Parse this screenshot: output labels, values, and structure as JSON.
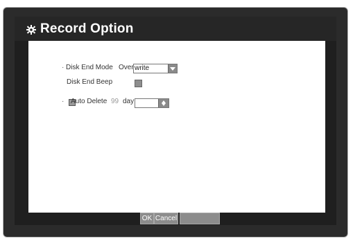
{
  "window": {
    "title": "Record Option"
  },
  "form": {
    "disk_end_mode": {
      "label": "Disk End Mode",
      "prefix_value": "Over",
      "value": "write"
    },
    "disk_end_beep": {
      "label": "Disk End Beep"
    },
    "auto_delete": {
      "label": "Auto Delete",
      "value": "99",
      "unit": "day"
    }
  },
  "buttons": {
    "ok": "OK",
    "cancel": "Cancel"
  },
  "colors": {
    "frame": "#2b2b2b",
    "panel": "#1f1f1f",
    "content": "#ffffff",
    "control_gray": "#8a8a8a"
  },
  "icons": {
    "title": "gear-icon",
    "dropdown": "chevron-down-icon",
    "spinner": "up-down-arrows-icon"
  }
}
